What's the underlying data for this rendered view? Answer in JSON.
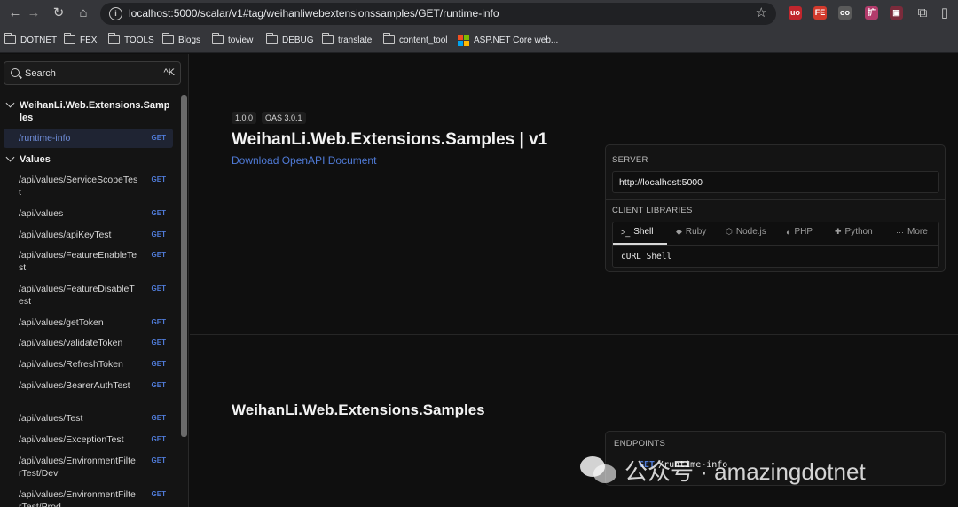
{
  "browser": {
    "url": "localhost:5000/scalar/v1#tag/weihanliwebextensionssamples/GET/runtime-info",
    "bookmarks": [
      "DOTNET",
      "FEX",
      "TOOLS",
      "Blogs",
      "toview",
      "DEBUG",
      "translate",
      "content_tool",
      "ASP.NET Core web..."
    ],
    "extensions": [
      "uo",
      "FE",
      "oo",
      "扩",
      "▣"
    ]
  },
  "sidebar": {
    "search_label": "Search",
    "search_shortcut": "^K",
    "groups": [
      {
        "label": "WeihanLi.Web.Extensions.Samples"
      },
      {
        "label": "Values"
      }
    ],
    "endpoints": [
      {
        "path": "/runtime-info",
        "method": "GET"
      },
      {
        "path": "/api/values/ServiceScopeTest",
        "method": "GET"
      },
      {
        "path": "/api/values",
        "method": "GET"
      },
      {
        "path": "/api/values/apiKeyTest",
        "method": "GET"
      },
      {
        "path": "/api/values/FeatureEnableTest",
        "method": "GET"
      },
      {
        "path": "/api/values/FeatureDisableTest",
        "method": "GET"
      },
      {
        "path": "/api/values/getToken",
        "method": "GET"
      },
      {
        "path": "/api/values/validateToken",
        "method": "GET"
      },
      {
        "path": "/api/values/RefreshToken",
        "method": "GET"
      },
      {
        "path": "/api/values/BearerAuthTest",
        "method": "GET"
      },
      {
        "path": "/api/values/Test",
        "method": "GET"
      },
      {
        "path": "/api/values/ExceptionTest",
        "method": "GET"
      },
      {
        "path": "/api/values/EnvironmentFilterTest/Dev",
        "method": "GET"
      },
      {
        "path": "/api/values/EnvironmentFilterTest/Prod",
        "method": "GET"
      }
    ]
  },
  "main": {
    "version": "1.0.0",
    "oas": "OAS 3.0.1",
    "title": "WeihanLi.Web.Extensions.Samples | v1",
    "download_link": "Download OpenAPI Document",
    "section_title": "WeihanLi.Web.Extensions.Samples",
    "server_label": "SERVER",
    "server_url": "http://localhost:5000",
    "client_libraries_label": "CLIENT LIBRARIES",
    "client_tabs": [
      {
        "label": "Shell",
        "icon": "terminal-icon"
      },
      {
        "label": "Ruby",
        "icon": "ruby-icon"
      },
      {
        "label": "Node.js",
        "icon": "nodejs-icon"
      },
      {
        "label": "PHP",
        "icon": "php-icon"
      },
      {
        "label": "Python",
        "icon": "python-icon"
      },
      {
        "label": "More",
        "icon": "more-icon"
      }
    ],
    "client_code": "cURL Shell",
    "endpoints_label": "ENDPOINTS",
    "endpoints_list": [
      {
        "method": "GET",
        "path": "/runtime-info"
      }
    ]
  },
  "watermark": "公众号 · amazingdotnet"
}
